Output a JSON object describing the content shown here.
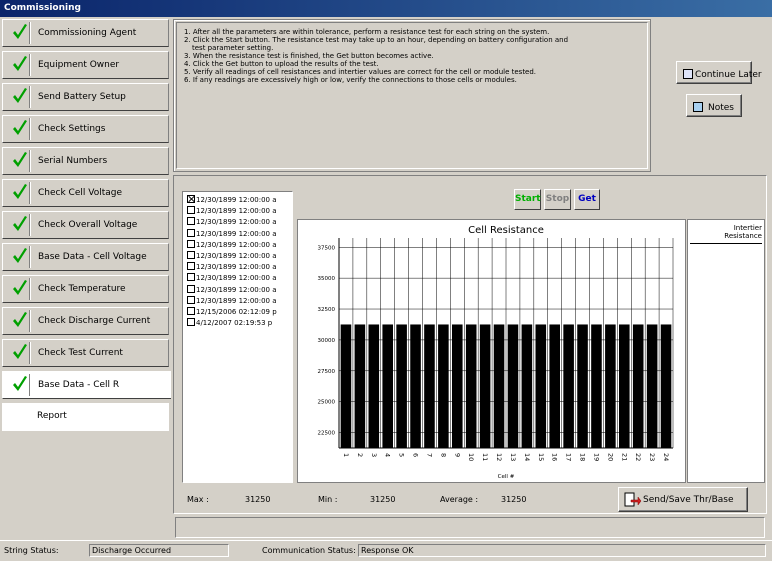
{
  "window": {
    "title": "Commissioning"
  },
  "sidebar": {
    "items": [
      {
        "label": "Commissioning Agent",
        "checked": true
      },
      {
        "label": "Equipment Owner",
        "checked": true
      },
      {
        "label": "Send Battery Setup",
        "checked": true
      },
      {
        "label": "Check Settings",
        "checked": true
      },
      {
        "label": "Serial Numbers",
        "checked": true
      },
      {
        "label": "Check Cell Voltage",
        "checked": true
      },
      {
        "label": "Check Overall Voltage",
        "checked": true
      },
      {
        "label": "Base Data - Cell Voltage",
        "checked": true
      },
      {
        "label": "Check Temperature",
        "checked": true
      },
      {
        "label": "Check Discharge Current",
        "checked": true
      },
      {
        "label": "Check Test Current",
        "checked": true
      },
      {
        "label": "Base Data - Cell R",
        "checked": true,
        "active": true
      },
      {
        "label": "Report",
        "checked": false
      }
    ]
  },
  "instructions": [
    "1. After all the parameters are within tolerance, perform a resistance test for each string on the system.",
    "2. Click the Start button. The resistance test may take up to an hour, depending on battery configuration and",
    "test parameter setting.",
    "3. When the resistance test is finished, the Get button becomes active.",
    "4. Click the Get button to upload the results of the test.",
    "5. Verify all readings of cell resistances and intertier values are correct for the cell or module tested.",
    "6. If any readings are excessively high or low, verify the connections to those cells or modules."
  ],
  "buttons": {
    "continue_later": "Continue Later",
    "notes": "Notes",
    "start": "Start",
    "stop": "Stop",
    "get": "Get",
    "send_save": "Send/Save Thr/Base"
  },
  "colors": {
    "start": "#00b000",
    "stop": "#808080",
    "get": "#0000c0",
    "title_bar": "#0a246a",
    "check": "#00a000"
  },
  "test_dates": [
    {
      "label": "12/30/1899 12:00:00 a",
      "checked": true
    },
    {
      "label": "12/30/1899 12:00:00 a",
      "checked": false
    },
    {
      "label": "12/30/1899 12:00:00 a",
      "checked": false
    },
    {
      "label": "12/30/1899 12:00:00 a",
      "checked": false
    },
    {
      "label": "12/30/1899 12:00:00 a",
      "checked": false
    },
    {
      "label": "12/30/1899 12:00:00 a",
      "checked": false
    },
    {
      "label": "12/30/1899 12:00:00 a",
      "checked": false
    },
    {
      "label": "12/30/1899 12:00:00 a",
      "checked": false
    },
    {
      "label": "12/30/1899 12:00:00 a",
      "checked": false
    },
    {
      "label": "12/30/1899 12:00:00 a",
      "checked": false
    },
    {
      "label": "12/15/2006 02:12:09 p",
      "checked": false
    },
    {
      "label": "4/12/2007 02:19:53 p",
      "checked": false
    }
  ],
  "chart_data": {
    "type": "bar",
    "title": "Cell Resistance",
    "xlabel": "Cell #",
    "ylabel": "",
    "categories": [
      "1",
      "2",
      "3",
      "4",
      "5",
      "6",
      "7",
      "8",
      "9",
      "10",
      "11",
      "12",
      "13",
      "14",
      "15",
      "16",
      "17",
      "18",
      "19",
      "20",
      "21",
      "22",
      "23",
      "24"
    ],
    "values": [
      31250,
      31250,
      31250,
      31250,
      31250,
      31250,
      31250,
      31250,
      31250,
      31250,
      31250,
      31250,
      31250,
      31250,
      31250,
      31250,
      31250,
      31250,
      31250,
      31250,
      31250,
      31250,
      31250,
      31250
    ],
    "yticks": [
      22500,
      25000,
      27500,
      30000,
      32500,
      35000,
      37500
    ],
    "ylim": [
      21250,
      38250
    ],
    "grid": true,
    "bar_color": "#000000"
  },
  "intertier": {
    "title_line1": "Intertier",
    "title_line2": "Resistance"
  },
  "stats": {
    "max_label": "Max :",
    "max_value": "31250",
    "min_label": "Min :",
    "min_value": "31250",
    "avg_label": "Average :",
    "avg_value": "31250"
  },
  "status": {
    "string_label": "String Status:",
    "string_value": "Discharge Occurred",
    "comm_label": "Communication Status:",
    "comm_value": "Response OK"
  }
}
